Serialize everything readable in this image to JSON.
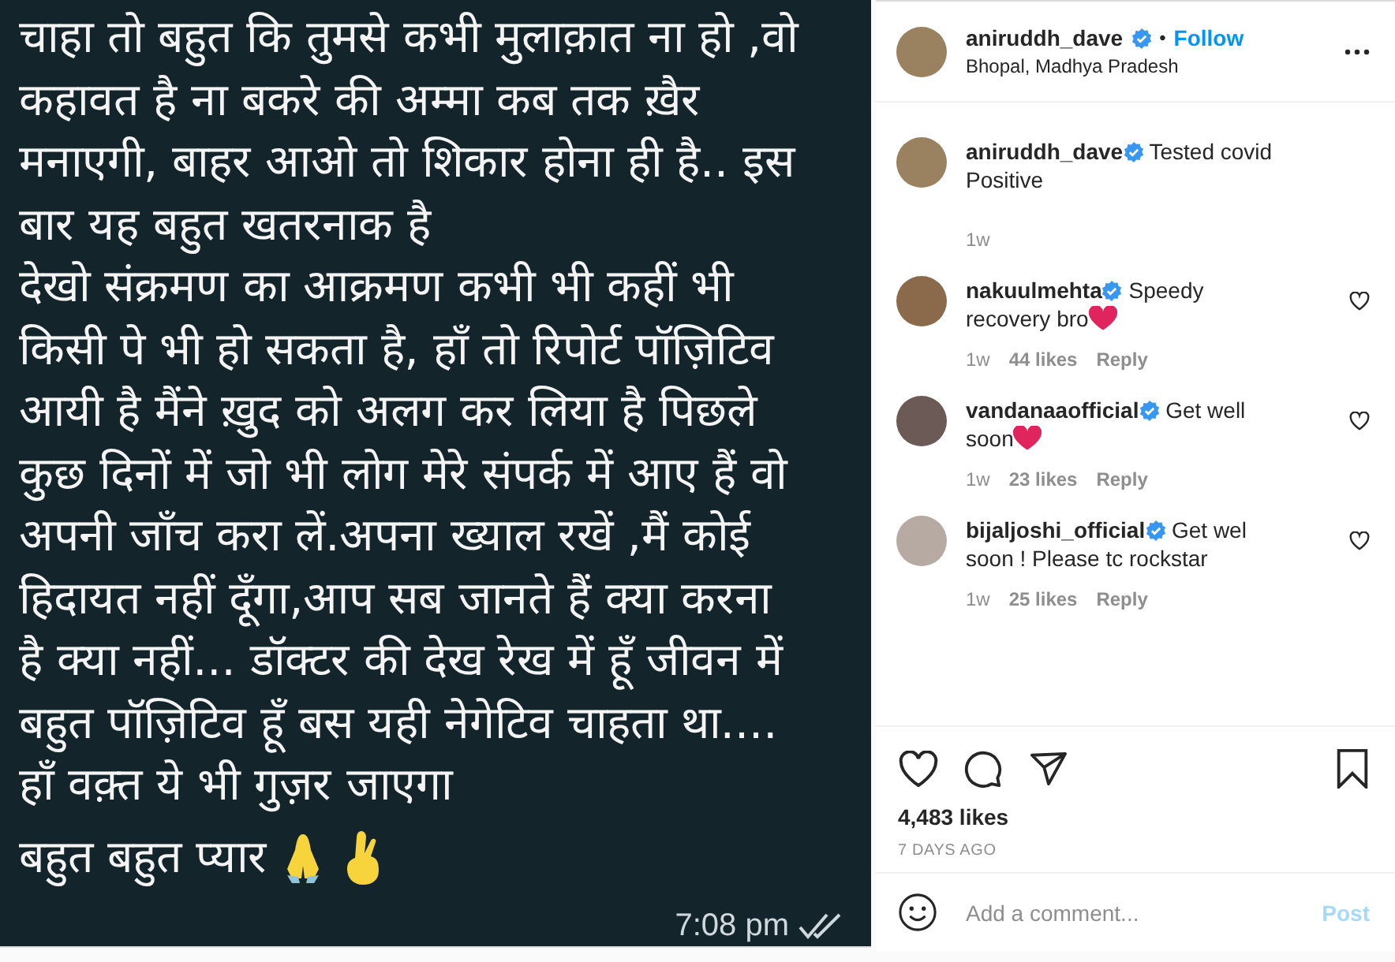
{
  "post_image": {
    "lines": [
      "चाहा तो बहुत कि तुमसे कभी मुलाक़ात ना हो ,वो",
      "कहावत है ना बकरे की अम्मा कब तक ख़ैर",
      "मनाएगी, बाहर आओ तो शिकार होना ही है.. इस",
      "बार यह बहुत खतरनाक है",
      "देखो संक्रमण का आक्रमण कभी भी कहीं भी",
      "किसी पे भी हो सकता है, हाँ तो रिपोर्ट पॉज़िटिव",
      "आयी है मैंने ख़ुद को अलग कर लिया है पिछले",
      "कुछ दिनों में जो भी लोग मेरे संपर्क में आए हैं वो",
      "अपनी जाँच करा लें.अपना ख्याल रखें ,मैं कोई",
      "हिदायत नहीं दूँगा,आप सब जानते हैं क्या करना",
      "है क्या नहीं... डॉक्टर की देख रेख में हूँ जीवन में",
      "बहुत पॉज़िटिव हूँ बस यही नेगेटिव चाहता था....",
      "हाँ वक़्त ये भी गुज़र जाएगा",
      "बहुत बहुत प्यार"
    ],
    "time": "7:08 pm"
  },
  "header": {
    "username": "aniruddh_dave",
    "verified": true,
    "separator": "•",
    "follow": "Follow",
    "location": "Bhopal, Madhya Pradesh"
  },
  "caption": {
    "username": "aniruddh_dave",
    "verified": true,
    "text": "Tested covid Positive",
    "time": "1w"
  },
  "comments": [
    {
      "username": "nakuulmehta",
      "verified": true,
      "text": "Speedy recovery bro",
      "heart": true,
      "time": "1w",
      "likes": "44 likes",
      "reply": "Reply",
      "color": "#8a6a4a"
    },
    {
      "username": "vandanaaofficial",
      "verified": true,
      "text": "Get well soon",
      "heart": true,
      "time": "1w",
      "likes": "23 likes",
      "reply": "Reply",
      "color": "#6b5a55"
    },
    {
      "username": "bijaljoshi_official",
      "verified": true,
      "text": "Get wel soon ! Please tc rockstar",
      "heart": false,
      "time": "1w",
      "likes": "25 likes",
      "reply": "Reply",
      "color": "#b7aaa2"
    }
  ],
  "likes": "4,483 likes",
  "date": "7 DAYS AGO",
  "comment_box": {
    "placeholder": "Add a comment...",
    "post": "Post",
    "disabled": true
  }
}
